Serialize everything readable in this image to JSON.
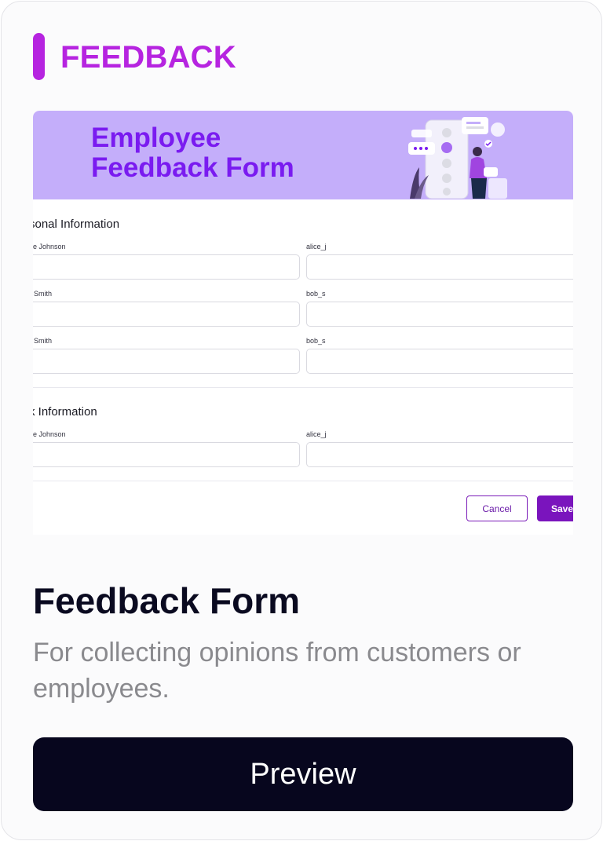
{
  "tag": {
    "label": "FEEDBACK",
    "color": "#b624e0"
  },
  "preview": {
    "banner": {
      "title": "Employee Feedback Form",
      "background": "#c4aefa",
      "title_color": "#7a1bf0",
      "illustration": "person-with-feedback-emoji-phone-illustration"
    },
    "sections": [
      {
        "title": "rsonal Information",
        "rows": [
          {
            "left_label": "e Johnson",
            "right_label": "alice_j",
            "left_value": "",
            "right_value": ""
          },
          {
            "left_label": "Smith",
            "right_label": "bob_s",
            "left_value": "",
            "right_value": ""
          },
          {
            "left_label": "Smith",
            "right_label": "bob_s",
            "left_value": "",
            "right_value": ""
          }
        ]
      },
      {
        "title": "rk Information",
        "rows": [
          {
            "left_label": "e Johnson",
            "right_label": "alice_j",
            "left_value": "",
            "right_value": ""
          }
        ]
      }
    ],
    "buttons": {
      "cancel": "Cancel",
      "save": "Save"
    }
  },
  "card": {
    "title": "Feedback Form",
    "description": "For collecting opinions from customers or employees.",
    "preview_button": "Preview"
  }
}
